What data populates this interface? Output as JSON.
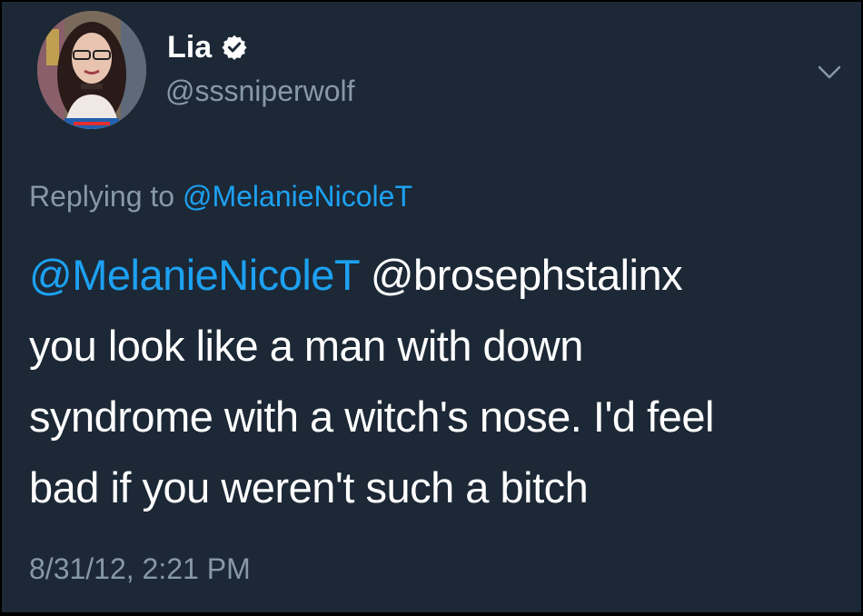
{
  "tweet": {
    "author": {
      "display_name": "Lia",
      "handle": "@sssniperwolf",
      "verified": true
    },
    "replying_prefix": "Replying to ",
    "replying_to": "@MelanieNicoleT",
    "mentions": [
      "@MelanieNicoleT",
      "@brosephstalinx"
    ],
    "body_lines": [
      "you look like a man with down",
      "syndrome with a witch's nose. I'd feel",
      "bad if you weren't such a bitch"
    ],
    "timestamp": "8/31/12, 2:21 PM"
  },
  "icons": {
    "verified": "verified-badge-icon",
    "menu": "chevron-down-icon"
  },
  "colors": {
    "background": "#1c2836",
    "text": "#ffffff",
    "secondary_text": "#8899a6",
    "link": "#1da1f2"
  }
}
